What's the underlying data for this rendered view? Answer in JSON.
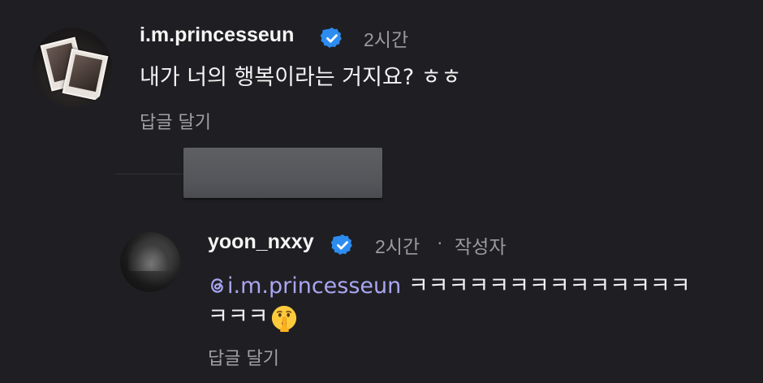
{
  "comment1": {
    "username": "i.m.princesseun",
    "time": "2시간",
    "text": "내가 너의 행복이라는 거지요? ㅎㅎ",
    "reply_label": "답글 달기"
  },
  "comment2": {
    "username": "yoon_nxxy",
    "time": "2시간",
    "separator": "·",
    "author_tag": "작성자",
    "mention": "i.m.princesseun",
    "text_line1": " ㅋㅋㅋㅋㅋㅋㅋㅋㅋㅋㅋㅋㅋㅋ",
    "text_line2": "ㅋㅋㅋ",
    "emoji": "shushing-face",
    "reply_label": "답글 달기"
  },
  "colors": {
    "background": "#1f1f23",
    "verified": "#2d8cf0",
    "mention": "#a9a6f2",
    "meta": "#9a9a9f"
  }
}
